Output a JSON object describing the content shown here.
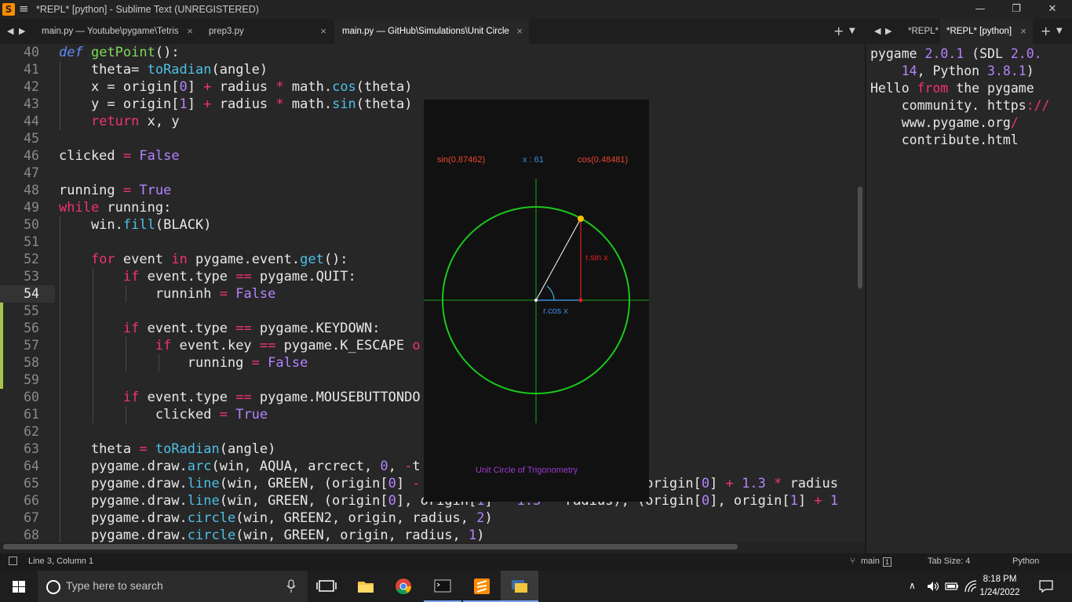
{
  "window": {
    "title": "*REPL* [python] - Sublime Text (UNREGISTERED)",
    "menu_glyph": "≡",
    "controls": {
      "minimize": "—",
      "maximize": "❐",
      "close": "✕"
    }
  },
  "tabs": [
    {
      "label": "main.py — Youtube\\pygame\\Tetris",
      "close": "×"
    },
    {
      "label": "prep3.py",
      "close": "×"
    },
    {
      "label": "main.py — GitHub\\Simulations\\Unit Circle",
      "close": "×"
    }
  ],
  "right_tabs": [
    {
      "label": "*REPL* ["
    },
    {
      "label": "*REPL* [python]",
      "close": "×"
    }
  ],
  "nav": {
    "back": "◀",
    "forward": "▶",
    "new_tab": "+",
    "dropdown": "▼"
  },
  "editor": {
    "line_numbers": [
      "40",
      "41",
      "42",
      "43",
      "44",
      "45",
      "46",
      "47",
      "48",
      "49",
      "50",
      "51",
      "52",
      "53",
      "54",
      "55",
      "56",
      "57",
      "58",
      "59",
      "60",
      "61",
      "62",
      "63",
      "64",
      "65",
      "66",
      "67",
      "68"
    ],
    "current_line": "54"
  },
  "repl": {
    "lines": [
      "pygame 2.0.1 (SDL 2.0.",
      "    14, Python 3.8.1)",
      "Hello from the pygame",
      "    community. https://",
      "    www.pygame.org/",
      "    contribute.html"
    ]
  },
  "pygame_window": {
    "sin_label": "sin(0.87462)",
    "x_label": "x : 61",
    "cos_label": "cos(0.48481)",
    "rsin_label": "r.sin x",
    "rcos_label": "r.cos x",
    "caption": "Unit Circle of Trigonometry",
    "colors": {
      "sin": "#e8452c",
      "x": "#3b8bdc",
      "cos": "#e8452c",
      "circle": "#19c819",
      "axes": "#19a819",
      "caption": "#9b3bd0",
      "point": "#ffbf00"
    }
  },
  "statusbar": {
    "position": "Line 3, Column 1",
    "branch": "main",
    "branch_count": "1",
    "tab_size": "Tab Size: 4",
    "syntax": "Python"
  },
  "taskbar": {
    "search_placeholder": "Type here to search",
    "time": "8:18 PM",
    "date": "1/24/2022"
  }
}
